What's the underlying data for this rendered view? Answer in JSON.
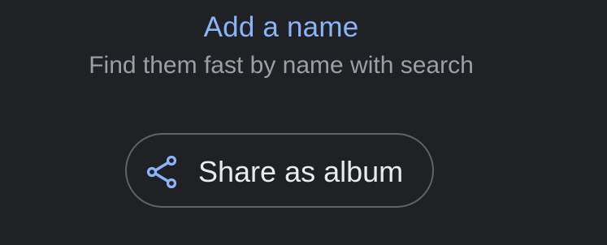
{
  "header": {
    "add_name_label": "Add a name",
    "subtitle": "Find them fast by name with search"
  },
  "actions": {
    "share_album_label": "Share as album",
    "share_icon": "share-icon"
  },
  "colors": {
    "background": "#202124",
    "accent": "#8ab4f8",
    "secondary_text": "#9aa0a6",
    "primary_text": "#e8eaed",
    "outline": "#5f6368"
  }
}
